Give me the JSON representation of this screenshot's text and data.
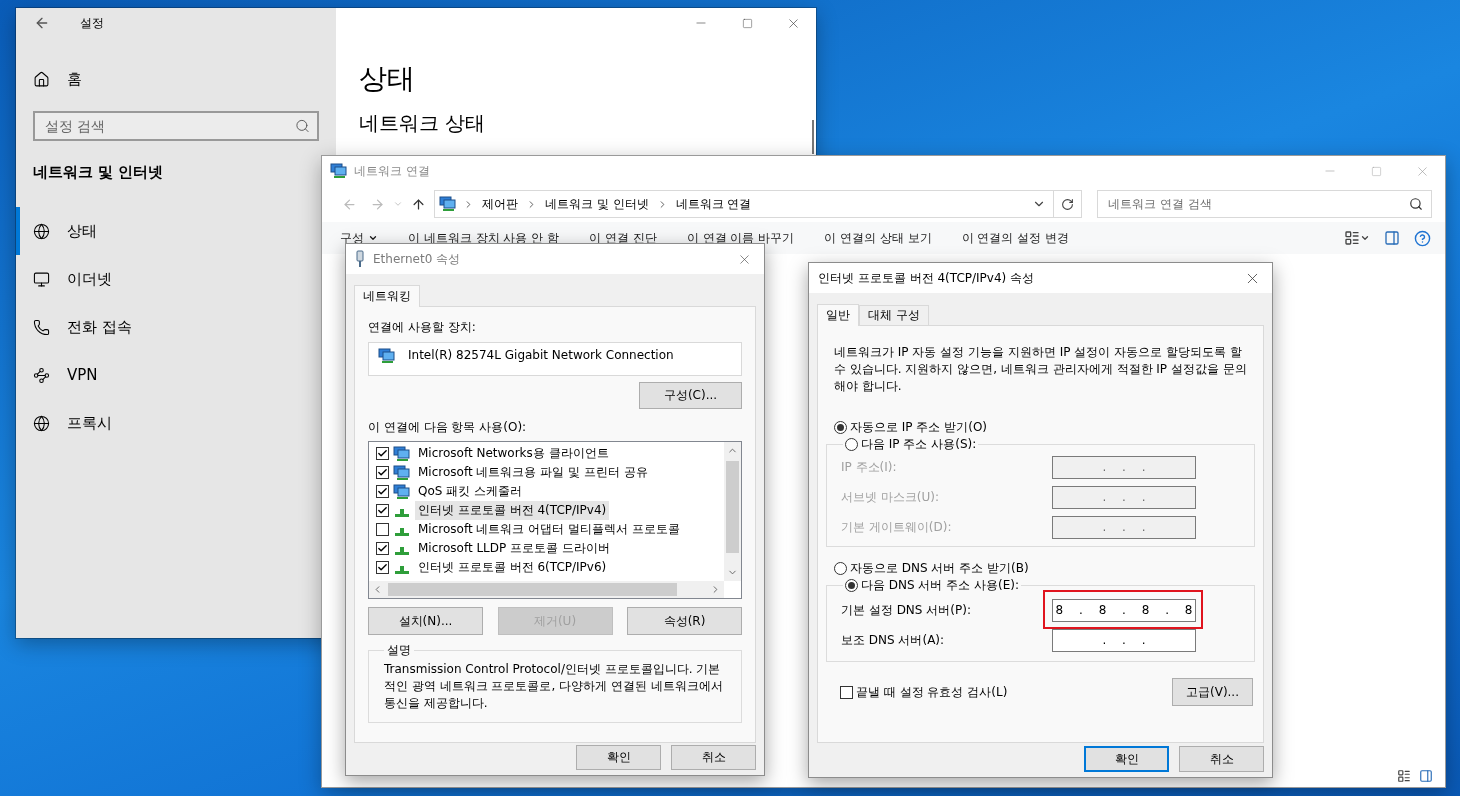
{
  "settings_window": {
    "title": "설정",
    "home": "홈",
    "search": {
      "placeholder": "설정 검색"
    },
    "section_title": "네트워크 및 인터넷",
    "nav_items": [
      {
        "label": "상태",
        "selected": true
      },
      {
        "label": "이더넷",
        "selected": false
      },
      {
        "label": "전화 접속",
        "selected": false
      },
      {
        "label": "VPN",
        "selected": false
      },
      {
        "label": "프록시",
        "selected": false
      }
    ],
    "page_title": "상태",
    "subheading": "네트워크 상태"
  },
  "network_window": {
    "title": "네트워크 연결",
    "breadcrumbs": [
      "제어판",
      "네트워크 및 인터넷",
      "네트워크 연결"
    ],
    "search": {
      "placeholder": "네트워크 연결 검색"
    },
    "toolbar": [
      {
        "label": "구성",
        "kind": "menu"
      },
      {
        "label": "이 네트워크 장치 사용 안 함",
        "kind": "command"
      },
      {
        "label": "이 연결 진단",
        "kind": "command"
      },
      {
        "label": "이 연결 이름 바꾸기",
        "kind": "command"
      },
      {
        "label": "이 연결의 상태 보기",
        "kind": "command"
      },
      {
        "label": "이 연결의 설정 변경",
        "kind": "command"
      }
    ]
  },
  "ethernet_dialog": {
    "title": "Ethernet0 속성",
    "tabs": [
      {
        "label": "네트워킹",
        "selected": true
      }
    ],
    "device_label": "연결에 사용할 장치:",
    "device": "Intel(R) 82574L Gigabit Network Connection",
    "configure_button": "구성(C)...",
    "items_label": "이 연결에 다음 항목 사용(O):",
    "items": [
      {
        "label": "Microsoft Networks용 클라이언트",
        "kind": "service",
        "checked": true,
        "selected": false
      },
      {
        "label": "Microsoft 네트워크용 파일 및 프린터 공유",
        "kind": "service",
        "checked": true,
        "selected": false
      },
      {
        "label": "QoS 패킷 스케줄러",
        "kind": "service",
        "checked": true,
        "selected": false
      },
      {
        "label": "인터넷 프로토콜 버전 4(TCP/IPv4)",
        "kind": "protocol",
        "checked": true,
        "selected": true
      },
      {
        "label": "Microsoft 네트워크 어댑터 멀티플렉서 프로토콜",
        "kind": "protocol",
        "checked": false,
        "selected": false
      },
      {
        "label": "Microsoft LLDP 프로토콜 드라이버",
        "kind": "protocol",
        "checked": true,
        "selected": false
      },
      {
        "label": "인터넷 프로토콜 버전 6(TCP/IPv6)",
        "kind": "protocol",
        "checked": true,
        "selected": false
      }
    ],
    "actions": [
      {
        "label": "설치(N)...",
        "disabled": false
      },
      {
        "label": "제거(U)",
        "disabled": true
      },
      {
        "label": "속성(R)",
        "disabled": false
      }
    ],
    "description": {
      "title": "설명",
      "text": "Transmission Control Protocol/인터넷 프로토콜입니다. 기본적인 광역 네트워크 프로토콜로, 다양하게 연결된 네트워크에서 통신을 제공합니다."
    },
    "buttons": [
      {
        "label": "확인",
        "default": false
      },
      {
        "label": "취소",
        "default": false
      }
    ]
  },
  "ipv4_dialog": {
    "title": "인터넷 프로토콜 버전 4(TCP/IPv4) 속성",
    "tabs": [
      {
        "label": "일반",
        "selected": true
      },
      {
        "label": "대체 구성",
        "selected": false
      }
    ],
    "intro": "네트워크가 IP 자동 설정 기능을 지원하면 IP 설정이 자동으로 할당되도록 할 수 있습니다. 지원하지 않으면, 네트워크 관리자에게 적절한 IP 설정값을 문의해야 합니다.",
    "ip_options": [
      {
        "label": "자동으로 IP 주소 받기(O)",
        "selected": true
      },
      {
        "label": "다음 IP 주소 사용(S):",
        "selected": false
      }
    ],
    "ip_fields": [
      {
        "label": "IP 주소(I):",
        "value": ". . .",
        "disabled": true,
        "highlighted": false
      },
      {
        "label": "서브넷 마스크(U):",
        "value": ". . .",
        "disabled": true,
        "highlighted": false
      },
      {
        "label": "기본 게이트웨이(D):",
        "value": ". . .",
        "disabled": true,
        "highlighted": false
      }
    ],
    "dns_options": [
      {
        "label": "자동으로 DNS 서버 주소 받기(B)",
        "selected": false
      },
      {
        "label": "다음 DNS 서버 주소 사용(E):",
        "selected": true
      }
    ],
    "dns_fields": [
      {
        "label": "기본 설정 DNS 서버(P):",
        "value": "8 . 8 . 8 . 8",
        "disabled": false,
        "highlighted": true
      },
      {
        "label": "보조 DNS 서버(A):",
        "value": ". . .",
        "disabled": false,
        "highlighted": false
      }
    ],
    "validate": {
      "label": "끝낼 때 설정 유효성 검사(L)",
      "checked": false
    },
    "advanced_button": "고급(V)...",
    "buttons": [
      {
        "label": "확인",
        "default": true
      },
      {
        "label": "취소",
        "default": false
      }
    ]
  }
}
